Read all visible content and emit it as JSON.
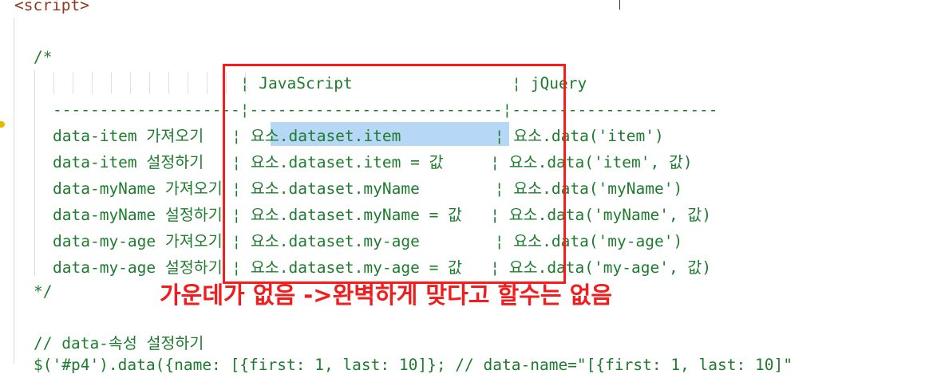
{
  "editor": {
    "line_script_tag": "<script>",
    "line_comment_open": "/*",
    "table_header": "                    ¦ JavaScript                 ¦ jQuery",
    "table_divider": "--------------------¦---------------------------¦----------------------",
    "rows": [
      "data-item 가져오기   ¦ 요소.dataset.item          ¦ 요소.data('item')",
      "data-item 설정하기   ¦ 요소.dataset.item = 값     ¦ 요소.data('item', 값)",
      "data-myName 가져오기 ¦ 요소.dataset.myName        ¦ 요소.data('myName')",
      "data-myName 설정하기 ¦ 요소.dataset.myName = 값   ¦ 요소.data('myName', 값)",
      "data-my-age 가져오기 ¦ 요소.dataset.my-age        ¦ 요소.data('my-age')",
      "data-my-age 설정하기 ¦ 요소.dataset.my-age = 값   ¦ 요소.data('my-age', 값)"
    ],
    "line_comment_close": "*/",
    "line_section_comment": "// data-속성 설정하기",
    "line_partial": "$('#p4').data({name: [{first: 1, last: 10]}; // data-name=\"[{first: 1, last: 10]\""
  },
  "annotation": {
    "note_text": "가운데가 없음 ->완벽하게 맞다고 할수는 없음",
    "box_color": "#ff1a1a"
  },
  "colors": {
    "code_green": "#1e7c2e",
    "tag_brown": "#8b3a1e",
    "selection": "#b6d7f5"
  }
}
